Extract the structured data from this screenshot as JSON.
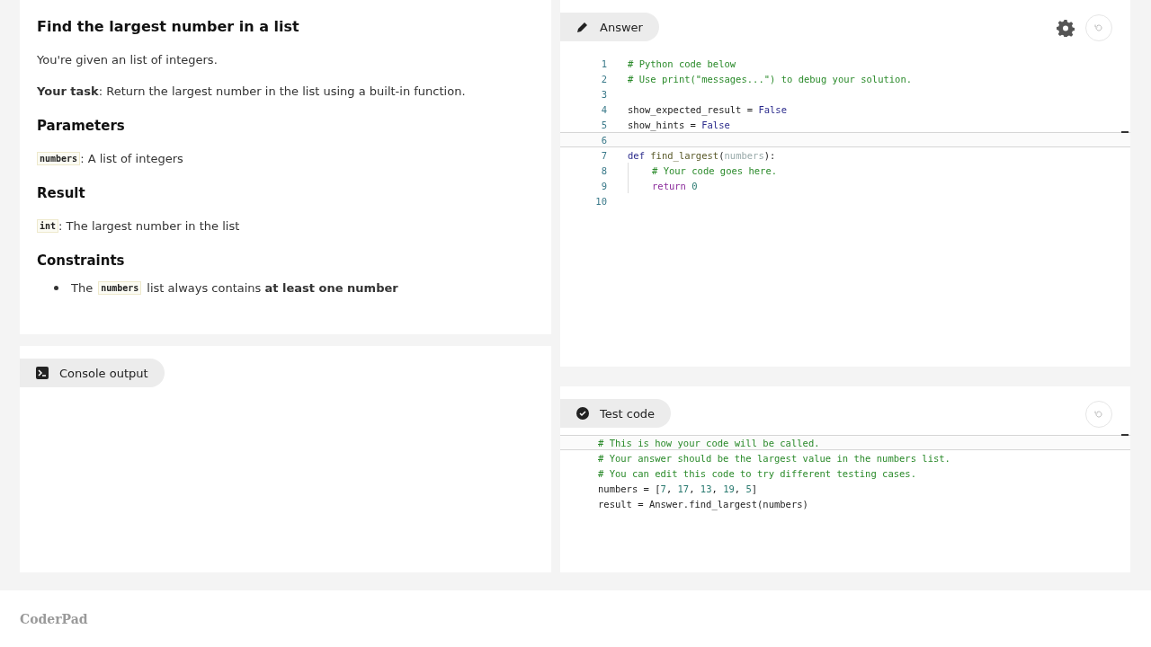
{
  "problem": {
    "title": "Find the largest number in a list",
    "intro": "You're given an list of integers.",
    "task": "**Your task**: Return the largest number in the list using a built-in function.",
    "sections": [
      {
        "heading": "Parameters",
        "code": "numbers",
        "text": ": A list of integers"
      },
      {
        "heading": "Result",
        "code": "int",
        "text": ": The largest number in the list"
      }
    ],
    "constraints_heading": "Constraints",
    "constraints": [
      [
        {
          "kind": "text",
          "text": "The"
        },
        {
          "kind": "code",
          "text": "numbers"
        },
        {
          "kind": "text",
          "text": "list always contains **at least one number**"
        }
      ]
    ]
  },
  "console": {
    "tab": "Console output"
  },
  "answer": {
    "tab": "Answer",
    "lines": [
      {
        "number": "1",
        "current": false,
        "indented": false,
        "tokens": [
          {
            "kind": "comment",
            "text": "# Python code below"
          }
        ]
      },
      {
        "number": "2",
        "current": false,
        "indented": false,
        "tokens": [
          {
            "kind": "comment",
            "text": "# Use print(\"messages...\") to debug your solution."
          }
        ]
      },
      {
        "number": "3",
        "current": false,
        "indented": false
      },
      {
        "number": "4",
        "current": false,
        "indented": false,
        "tokens": [
          {
            "kind": "plain",
            "text": "show_expected_result = "
          },
          {
            "kind": "keyword",
            "text": "False"
          }
        ]
      },
      {
        "number": "5",
        "current": false,
        "indented": false,
        "tokens": [
          {
            "kind": "plain",
            "text": "show_hints = "
          },
          {
            "kind": "keyword",
            "text": "False"
          }
        ]
      },
      {
        "number": "6",
        "current": true,
        "indented": false
      },
      {
        "number": "7",
        "current": false,
        "indented": false,
        "tokens": [
          {
            "kind": "keyword",
            "text": "def "
          },
          {
            "kind": "func",
            "text": "find_largest"
          },
          {
            "kind": "plain",
            "text": "("
          },
          {
            "kind": "param",
            "text": "numbers"
          },
          {
            "kind": "plain",
            "text": "):"
          }
        ]
      },
      {
        "number": "8",
        "current": false,
        "indented": true,
        "tokens": [
          {
            "kind": "comment",
            "text": "# Your code goes here."
          }
        ]
      },
      {
        "number": "9",
        "current": false,
        "indented": true,
        "tokens": [
          {
            "kind": "control",
            "text": "return "
          },
          {
            "kind": "number",
            "text": "0"
          }
        ]
      },
      {
        "number": "10",
        "current": false,
        "indented": false
      }
    ]
  },
  "test": {
    "tab": "Test code",
    "lines": [
      {
        "current": true,
        "tokens": [
          {
            "kind": "comment",
            "text": "# This is how your code will be called."
          }
        ]
      },
      {
        "current": false,
        "tokens": [
          {
            "kind": "comment",
            "text": "# Your answer should be the largest value in the numbers list."
          }
        ]
      },
      {
        "current": false,
        "tokens": [
          {
            "kind": "comment",
            "text": "# You can edit this code to try different testing cases."
          }
        ]
      },
      {
        "current": false,
        "tokens": [
          {
            "kind": "plain",
            "text": "numbers = ["
          },
          {
            "kind": "number",
            "text": "7"
          },
          {
            "kind": "plain",
            "text": ", "
          },
          {
            "kind": "number",
            "text": "17"
          },
          {
            "kind": "plain",
            "text": ", "
          },
          {
            "kind": "number",
            "text": "13"
          },
          {
            "kind": "plain",
            "text": ", "
          },
          {
            "kind": "number",
            "text": "19"
          },
          {
            "kind": "plain",
            "text": ", "
          },
          {
            "kind": "number",
            "text": "5"
          },
          {
            "kind": "plain",
            "text": "]"
          }
        ]
      },
      {
        "current": false,
        "tokens": [
          {
            "kind": "plain",
            "text": "result = Answer.find_largest(numbers)"
          }
        ]
      }
    ]
  },
  "footer": {
    "brand": "CoderPad"
  }
}
